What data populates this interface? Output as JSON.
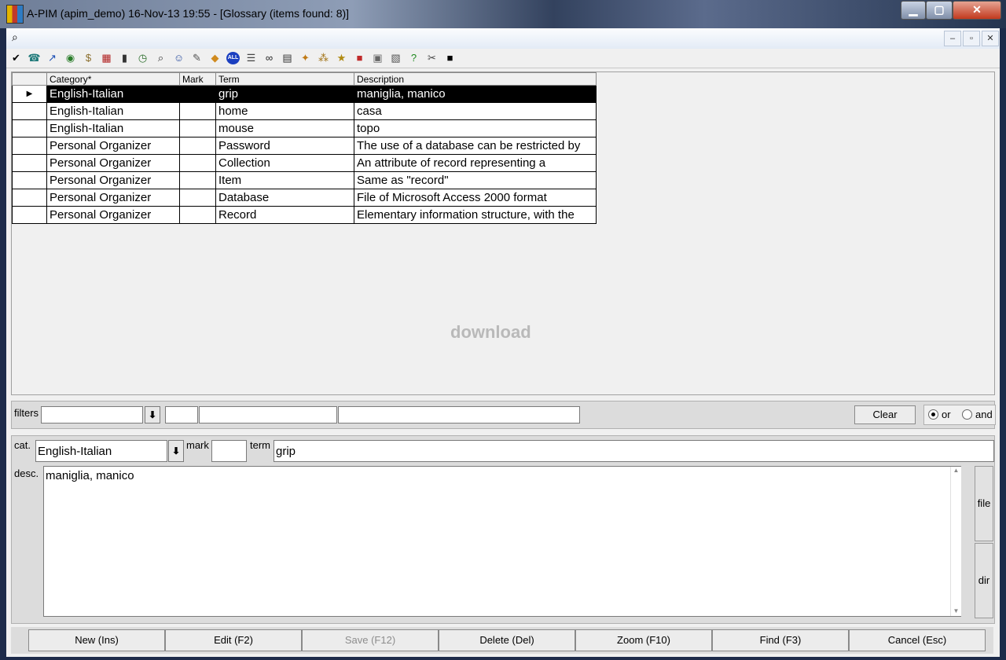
{
  "window": {
    "title": "A-PIM (apim_demo) 16-Nov-13 19:55 - [Glossary (items found: 8)]",
    "minimize_icon": "minimize-icon",
    "maximize_icon": "maximize-icon",
    "close_icon": "close-icon"
  },
  "mdi": {
    "icon": "find-window-icon",
    "min_label": "–",
    "restore_label": "▫",
    "close_label": "✕"
  },
  "toolbar": {
    "icons": [
      {
        "name": "check-icon",
        "glyph": "✔",
        "color": "#000000"
      },
      {
        "name": "phone-icon",
        "glyph": "☎",
        "color": "#1f7a7a"
      },
      {
        "name": "arrow-icon",
        "glyph": "↗",
        "color": "#1c4fb5"
      },
      {
        "name": "globe-icon",
        "glyph": "◉",
        "color": "#2a7d2a"
      },
      {
        "name": "money-bag-icon",
        "glyph": "$",
        "color": "#8a6d2b"
      },
      {
        "name": "calendar-icon",
        "glyph": "▦",
        "color": "#b02020"
      },
      {
        "name": "chart-icon",
        "glyph": "▮",
        "color": "#333333"
      },
      {
        "name": "clock-icon",
        "glyph": "◷",
        "color": "#2b6e2b"
      },
      {
        "name": "search-icon",
        "glyph": "⌕",
        "color": "#333333"
      },
      {
        "name": "person-icon",
        "glyph": "☺",
        "color": "#2c4fa0"
      },
      {
        "name": "notes-icon",
        "glyph": "✎",
        "color": "#555555"
      },
      {
        "name": "book-icon",
        "glyph": "◆",
        "color": "#d08a1e"
      },
      {
        "name": "all-icon",
        "glyph": "ALL",
        "color": "#1b3fc0"
      },
      {
        "name": "list-icon",
        "glyph": "☰",
        "color": "#444444"
      },
      {
        "name": "binoculars-icon",
        "glyph": "∞",
        "color": "#222222"
      },
      {
        "name": "table-icon",
        "glyph": "▤",
        "color": "#333333"
      },
      {
        "name": "palette-icon",
        "glyph": "✦",
        "color": "#c07a15"
      },
      {
        "name": "network-icon",
        "glyph": "⁂",
        "color": "#a07010"
      },
      {
        "name": "star-note-icon",
        "glyph": "★",
        "color": "#b08a10"
      },
      {
        "name": "printer-color-icon",
        "glyph": "■",
        "color": "#c02a2a"
      },
      {
        "name": "lock-icon",
        "glyph": "▣",
        "color": "#666666"
      },
      {
        "name": "archive-icon",
        "glyph": "▧",
        "color": "#555555"
      },
      {
        "name": "help-icon",
        "glyph": "?",
        "color": "#1f8a1f"
      },
      {
        "name": "tools-icon",
        "glyph": "✂",
        "color": "#444444"
      },
      {
        "name": "console-icon",
        "glyph": "■",
        "color": "#000000"
      }
    ]
  },
  "grid": {
    "headers": {
      "category": "Category*",
      "mark": "Mark",
      "term": "Term",
      "description": "Description"
    },
    "rows": [
      {
        "category": "English-Italian",
        "mark": "",
        "term": "grip",
        "description": "maniglia, manico",
        "selected": true
      },
      {
        "category": "English-Italian",
        "mark": "",
        "term": "home",
        "description": "casa"
      },
      {
        "category": "English-Italian",
        "mark": "",
        "term": "mouse",
        "description": "topo"
      },
      {
        "category": "Personal Organizer",
        "mark": "",
        "term": "Password",
        "description": "The use of a database can be restricted by"
      },
      {
        "category": "Personal Organizer",
        "mark": "",
        "term": "Collection",
        "description": "An attribute of record representing a"
      },
      {
        "category": "Personal Organizer",
        "mark": "",
        "term": "Item",
        "description": "Same as \"record\""
      },
      {
        "category": "Personal Organizer",
        "mark": "",
        "term": "Database",
        "description": "File of Microsoft Access 2000 format"
      },
      {
        "category": "Personal Organizer",
        "mark": "",
        "term": "Record",
        "description": "Elementary information structure, with the"
      }
    ],
    "selected_marker": "▶"
  },
  "watermark": "download",
  "filters": {
    "label": "filters",
    "dropdown_glyph": "⬇",
    "clear_label": "Clear",
    "or_label": "or",
    "and_label": "and",
    "mode": "or"
  },
  "edit": {
    "cat_label": "cat.",
    "cat_value": "English-Italian",
    "mark_label": "mark",
    "mark_value": "",
    "term_label": "term",
    "term_value": "grip",
    "desc_label": "desc.",
    "desc_value": "maniglia, manico",
    "file_label": "file",
    "dir_label": "dir"
  },
  "actions": {
    "new": "New (Ins)",
    "edit": "Edit (F2)",
    "save": "Save (F12)",
    "delete": "Delete (Del)",
    "zoom": "Zoom (F10)",
    "find": "Find (F3)",
    "cancel": "Cancel (Esc)"
  }
}
